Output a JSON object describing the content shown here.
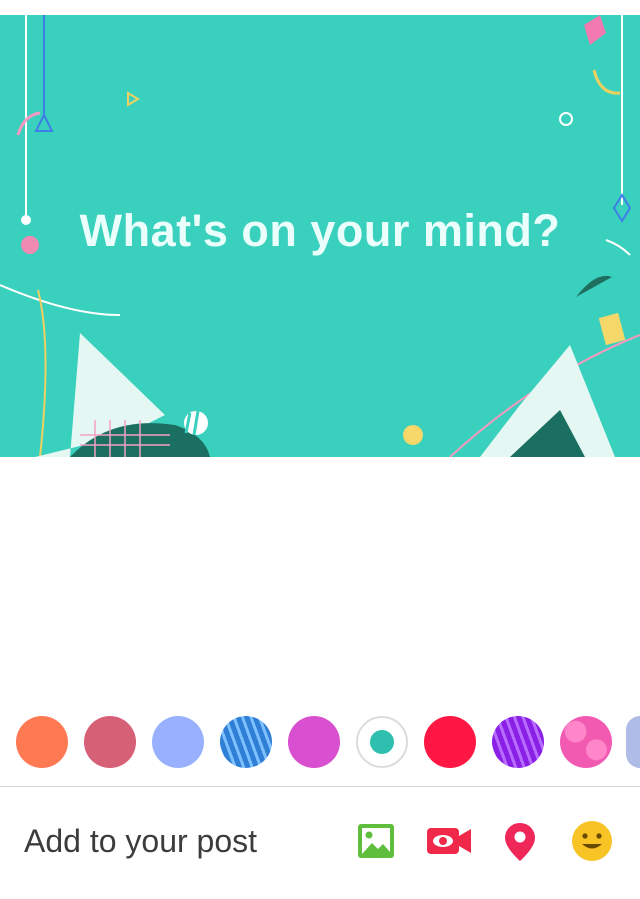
{
  "composer": {
    "prompt": "What's on your mind?",
    "background": "#39d0bd"
  },
  "palette": {
    "swatches": [
      {
        "name": "orange-dotted",
        "color": "#ff7a52"
      },
      {
        "name": "pink-muted",
        "color": "#d66076"
      },
      {
        "name": "periwinkle",
        "color": "#99b0ff"
      },
      {
        "name": "blue-pattern",
        "color": "#3f8fe0"
      },
      {
        "name": "magenta",
        "color": "#d84fd0"
      },
      {
        "name": "teal-selected",
        "color": "#2fbfae",
        "selected": true
      },
      {
        "name": "red",
        "color": "#ff1744"
      },
      {
        "name": "purple-pattern",
        "color": "#9b2cf0"
      },
      {
        "name": "pink-hearts",
        "color": "#f25ab2"
      }
    ]
  },
  "add_bar": {
    "label": "Add to your post",
    "tools": [
      {
        "icon": "photo-icon",
        "color": "#5fbf3c"
      },
      {
        "icon": "video-icon",
        "color": "#f02849"
      },
      {
        "icon": "location-pin-icon",
        "color": "#f0285a"
      },
      {
        "icon": "smiley-icon",
        "color": "#f7c325"
      }
    ]
  }
}
